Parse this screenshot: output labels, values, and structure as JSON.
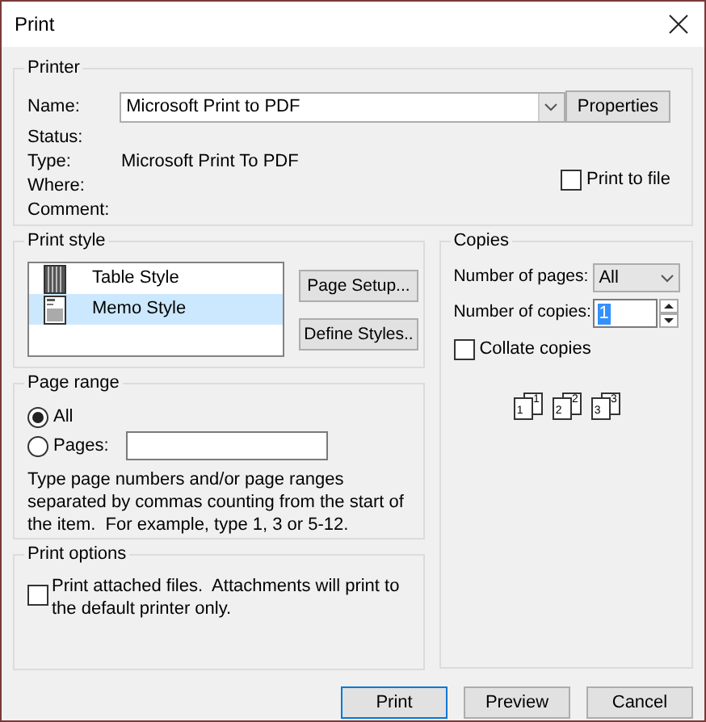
{
  "window": {
    "title": "Print"
  },
  "printer": {
    "label": "Printer",
    "name_label": "Name:",
    "name_value": "Microsoft Print to PDF",
    "properties_button": "Properties",
    "info": [
      {
        "label": "Status:"
      },
      {
        "label": "Type:",
        "value": "Microsoft Print To PDF"
      },
      {
        "label": "Where:"
      },
      {
        "label": "Comment:"
      }
    ],
    "print_to_file": {
      "label": "Print to file",
      "checked": false
    }
  },
  "print_style": {
    "label": "Print style",
    "styles": [
      {
        "name": "Table Style",
        "kind": "table",
        "selected": false
      },
      {
        "name": "Memo Style",
        "kind": "memo",
        "selected": true
      }
    ],
    "buttons": [
      "Page Setup...",
      "Define Styles.."
    ]
  },
  "page_range": {
    "label": "Page range",
    "options": [
      {
        "label": "All",
        "selected": true
      },
      {
        "label": "Pages:",
        "selected": false
      }
    ],
    "hint": "Type page numbers and/or page ranges separated by commas counting from the start of the item.  For example, type 1, 3 or 5-12."
  },
  "print_options": {
    "label": "Print options",
    "attach": {
      "label": "Print attached files.  Attachments will print to the default printer only.",
      "checked": false
    }
  },
  "copies": {
    "label": "Copies",
    "pages_label": "Number of pages:",
    "pages_value": "All",
    "copies_label": "Number of copies:",
    "copies_value": "1",
    "collate": {
      "label": "Collate copies",
      "checked": false
    },
    "collate_pages": [
      {
        "front": "1",
        "back": "1"
      },
      {
        "front": "2",
        "back": "2"
      },
      {
        "front": "3",
        "back": "3"
      }
    ]
  },
  "buttons": [
    {
      "label": "Print",
      "default": true
    },
    {
      "label": "Preview",
      "default": false
    },
    {
      "label": "Cancel",
      "default": false
    }
  ]
}
